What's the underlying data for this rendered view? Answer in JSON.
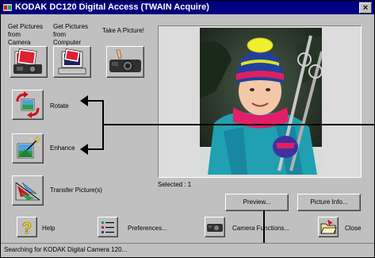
{
  "window": {
    "title": "KODAK DC120 Digital Access (TWAIN Acquire)",
    "close_glyph": "×"
  },
  "top_labels": {
    "from_camera": "Get Pictures from Camera",
    "from_computer": "Get Pictures from Computer",
    "take_picture": "Take A Picture!"
  },
  "tools": {
    "rotate": "Rotate",
    "enhance": "Enhance",
    "transfer": "Transfer Picture(s)"
  },
  "preview": {
    "selected": "Selected : 1",
    "preview_button": "Preview...",
    "info_button": "Picture Info..."
  },
  "bottom": {
    "help": "Help",
    "preferences": "Preferences...",
    "camera_functions": "Camera Functions...",
    "close": "Close"
  },
  "status": {
    "text": "Searching for KODAK Digital Camera 120..."
  },
  "colors": {
    "title_bar": "#000080",
    "face": "#c0c0c0",
    "accent_red": "#d01020",
    "accent_green": "#20a040"
  }
}
